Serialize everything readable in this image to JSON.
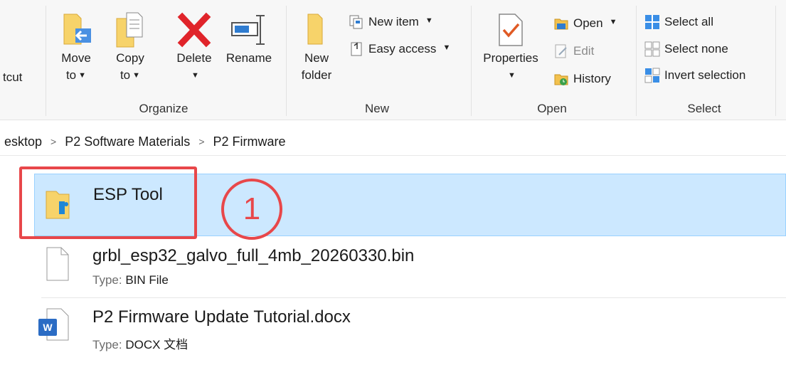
{
  "ribbon": {
    "cut_label": "tcut",
    "organize": {
      "group_label": "Organize",
      "move_to": [
        "Move",
        "to"
      ],
      "copy_to": [
        "Copy",
        "to"
      ],
      "delete": "Delete",
      "rename": "Rename"
    },
    "new": {
      "group_label": "New",
      "new_folder": [
        "New",
        "folder"
      ],
      "new_item": "New item",
      "easy_access": "Easy access"
    },
    "open": {
      "group_label": "Open",
      "properties": "Properties",
      "open": "Open",
      "edit": "Edit",
      "history": "History"
    },
    "select": {
      "group_label": "Select",
      "select_all": "Select all",
      "select_none": "Select none",
      "invert_selection": "Invert selection"
    }
  },
  "address": {
    "crumbs": [
      "esktop",
      "P2 Software Materials",
      "P2 Firmware"
    ]
  },
  "files": [
    {
      "name": "ESP Tool",
      "type_label": "",
      "type_value": "",
      "icon": "folder-icon",
      "selected": true
    },
    {
      "name": "grbl_esp32_galvo_full_4mb_20260330.bin",
      "type_label": "Type:",
      "type_value": "BIN File",
      "icon": "file-icon",
      "selected": false
    },
    {
      "name": "P2 Firmware Update Tutorial.docx",
      "type_label": "Type:",
      "type_value": "DOCX 文档",
      "icon": "word-doc-icon",
      "selected": false
    }
  ],
  "annotation": {
    "number": "1",
    "color": "#e8474a"
  },
  "colors": {
    "selection": "#cce8ff",
    "selection_border": "#99d1ff",
    "accent": "#0078d7"
  }
}
